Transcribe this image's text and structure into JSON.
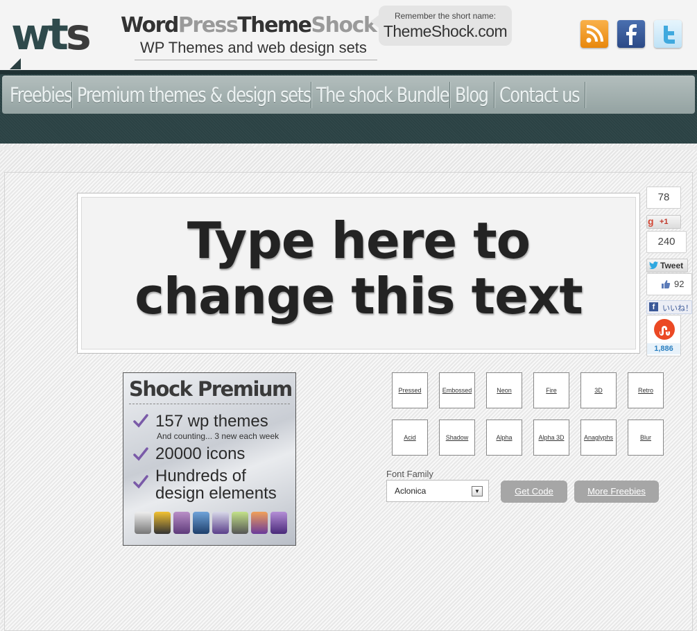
{
  "header": {
    "logo_mark_w": "wt",
    "logo_mark_s": "s",
    "title_part1": "Word",
    "title_part2": "Press",
    "title_part3": "Theme",
    "title_part4": "Shock",
    "subtitle": "WP Themes and web design sets",
    "bubble_top": "Remember the short name:",
    "bubble_main": "ThemeShock.com",
    "social": [
      "rss-icon",
      "facebook-icon",
      "twitter-icon"
    ]
  },
  "nav": {
    "items": [
      "Freebies",
      "Premium themes & design sets",
      "The shock Bundle",
      "Blog",
      "Contact us"
    ]
  },
  "preview": {
    "line1": "Type here to",
    "line2": "change this text"
  },
  "share": {
    "gplus_count": "78",
    "gplus_label": "+1",
    "tweet_count": "240",
    "tweet_label": "Tweet",
    "like_count": "92",
    "fb_label": "いいね！",
    "stumble_count": "1,886"
  },
  "premium": {
    "title": "Shock Premium",
    "item1": "157 wp themes",
    "item1_sub": "And counting... 3 new each week",
    "item2": "20000 icons",
    "item3_line1": "Hundreds of",
    "item3_line2": "design elements"
  },
  "effects": [
    "Pressed",
    "Embossed",
    "Neon",
    "Fire",
    "3D",
    "Retro",
    "Acid",
    "Shadow",
    "Alpha",
    "Alpha 3D",
    "Anaglyphs",
    "Blur"
  ],
  "controls": {
    "font_label": "Font Family",
    "font_value": "Aclonica",
    "get_code": "Get Code",
    "more_freebies": "More Freebies"
  },
  "colors": {
    "nav_band": "#2b4244",
    "nav_bar": "#9eacab",
    "button": "#a6a6a6",
    "stumble": "#eb4924"
  }
}
